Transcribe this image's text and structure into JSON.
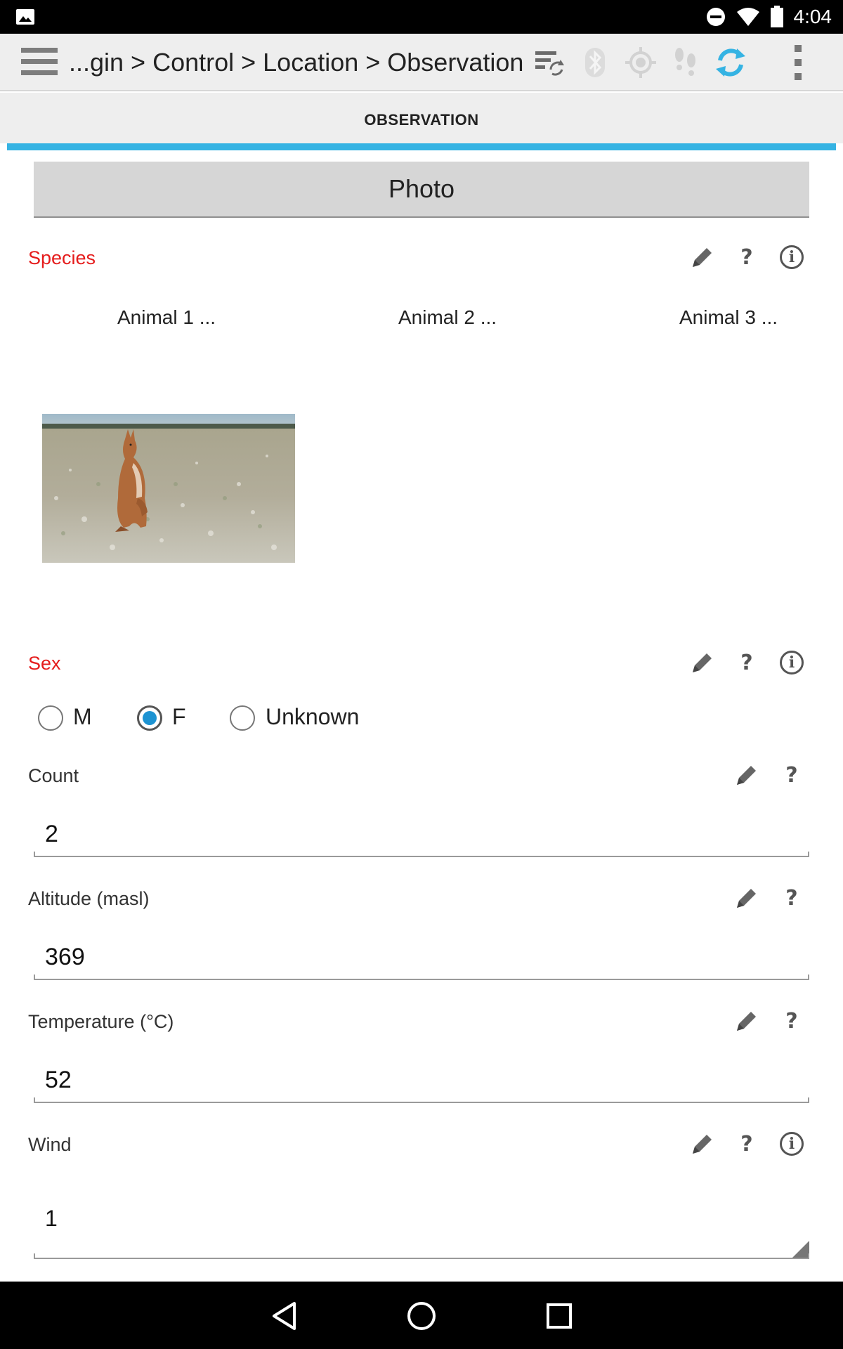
{
  "status_bar": {
    "time": "4:04",
    "icons": [
      "gallery-icon",
      "do-not-disturb-icon",
      "wifi-icon",
      "battery-icon"
    ]
  },
  "action_bar": {
    "breadcrumb": "...gin > Control > Location > Observation",
    "icons": [
      "menu-icon",
      "sync-list-icon",
      "bluetooth-icon",
      "gps-icon",
      "footsteps-icon",
      "refresh-icon",
      "overflow-menu-icon"
    ],
    "accent_color": "#35b3e3"
  },
  "tab": {
    "label": "OBSERVATION"
  },
  "photo_button": {
    "label": "Photo"
  },
  "species": {
    "label": "Species",
    "options": [
      "Animal 1 ...",
      "Animal 2 ...",
      "Animal 3 ..."
    ],
    "label_color": "#e51c1c"
  },
  "sex": {
    "label": "Sex",
    "options": [
      "M",
      "F",
      "Unknown"
    ],
    "selected": "F"
  },
  "count": {
    "label": "Count",
    "value": "2"
  },
  "altitude": {
    "label": "Altitude (masl)",
    "value": "369"
  },
  "temperature": {
    "label": "Temperature (°C)",
    "value": "52"
  },
  "wind": {
    "label": "Wind",
    "value": "1"
  },
  "help_glyph": "?",
  "nav_bar": {
    "icons": [
      "back-icon",
      "home-icon",
      "recents-icon"
    ]
  }
}
